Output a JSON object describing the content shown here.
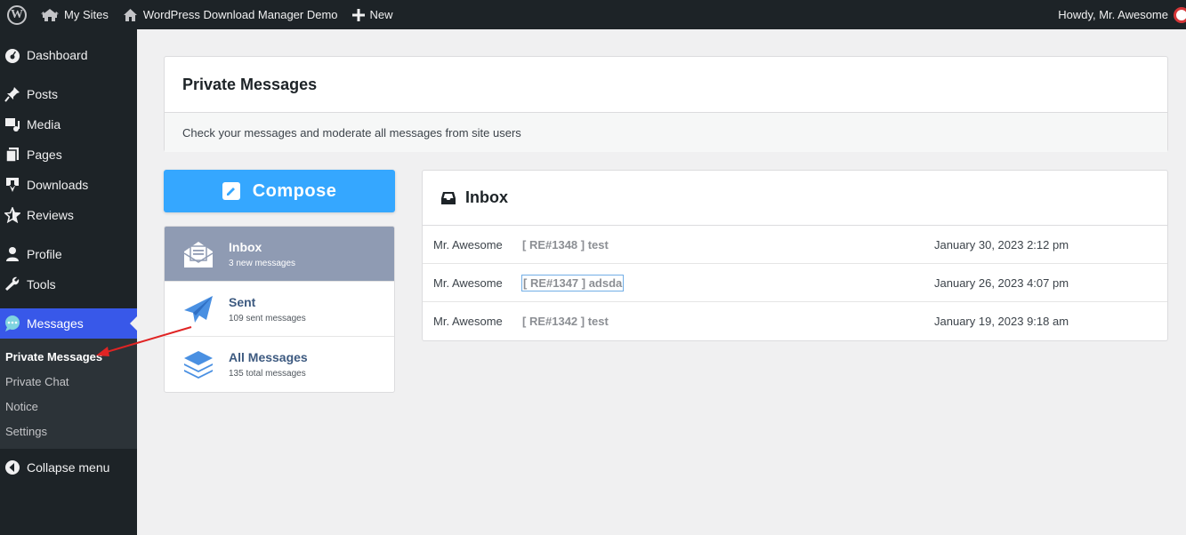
{
  "adminbar": {
    "my_sites": "My Sites",
    "site_name": "WordPress Download Manager Demo",
    "new_label": "New",
    "greeting": "Howdy, Mr. Awesome"
  },
  "sidebar": {
    "items": [
      {
        "label": "Dashboard",
        "icon": "dashboard-icon"
      },
      {
        "label": "Posts",
        "icon": "pin-icon"
      },
      {
        "label": "Media",
        "icon": "media-icon"
      },
      {
        "label": "Pages",
        "icon": "pages-icon"
      },
      {
        "label": "Downloads",
        "icon": "download-icon"
      },
      {
        "label": "Reviews",
        "icon": "star-icon"
      },
      {
        "label": "Profile",
        "icon": "user-icon"
      },
      {
        "label": "Tools",
        "icon": "wrench-icon"
      },
      {
        "label": "Messages",
        "icon": "chat-icon"
      }
    ],
    "submenu": [
      "Private Messages",
      "Private Chat",
      "Notice",
      "Settings"
    ],
    "collapse": "Collapse menu"
  },
  "page": {
    "title": "Private Messages",
    "description": "Check your messages and moderate all messages from site users"
  },
  "compose_label": "Compose",
  "folders": [
    {
      "title": "Inbox",
      "sub": "3 new messages"
    },
    {
      "title": "Sent",
      "sub": "109 sent messages"
    },
    {
      "title": "All Messages",
      "sub": "135 total messages"
    }
  ],
  "inbox": {
    "title": "Inbox",
    "messages": [
      {
        "from": "Mr. Awesome",
        "subject": "[ RE#1348 ] test",
        "date": "January 30, 2023 2:12 pm"
      },
      {
        "from": "Mr. Awesome",
        "subject": "[ RE#1347 ] adsda",
        "date": "January 26, 2023 4:07 pm"
      },
      {
        "from": "Mr. Awesome",
        "subject": "[ RE#1342 ] test",
        "date": "January 19, 2023 9:18 am"
      }
    ]
  },
  "colors": {
    "accent": "#3858e9",
    "compose": "#35a7ff",
    "folder_active": "#8f9bb3",
    "arrow": "#e02424"
  }
}
